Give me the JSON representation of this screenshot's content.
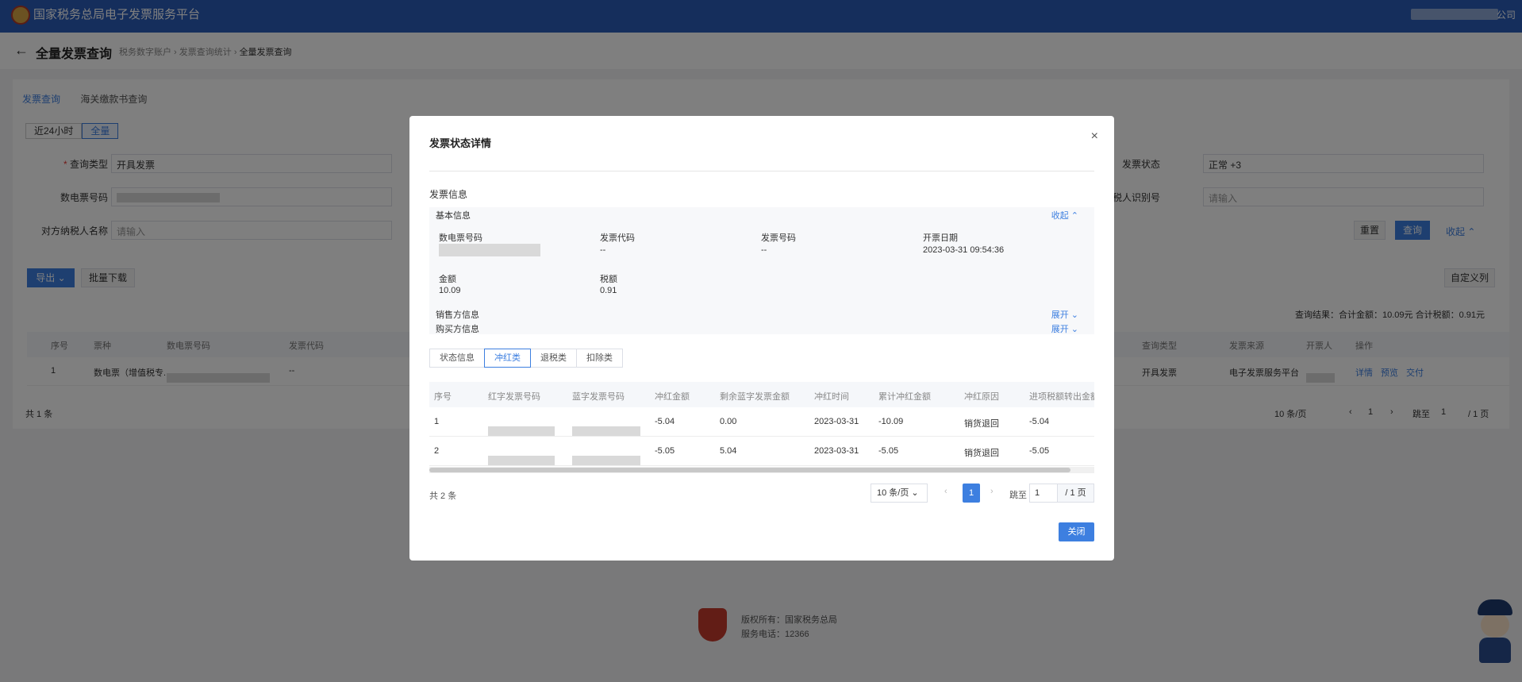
{
  "topbar": {
    "title": "国家税务总局电子发票服务平台",
    "user_suffix": "公司"
  },
  "page": {
    "back": "←",
    "title": "全量发票查询",
    "breadcrumb": [
      "税务数字账户",
      "发票查询统计",
      "全量发票查询"
    ],
    "tabs": [
      "发票查询",
      "海关缴款书查询"
    ],
    "time_filters": [
      "近24小时",
      "全量"
    ],
    "form": {
      "query_type_label": "查询类型",
      "query_type_value": "开具发票",
      "e_invoice_no_label": "数电票号码",
      "counterparty_name_label": "对方纳税人名称",
      "counterparty_name_placeholder": "请输入",
      "invoice_status_label": "发票状态",
      "invoice_status_tag1": "正常",
      "invoice_status_tag2": "+3",
      "counterparty_id_label": "对方纳税人识别号",
      "counterparty_id_placeholder": "请输入"
    },
    "buttons": {
      "reset": "重置",
      "query": "查询",
      "collapse": "收起 ⌃",
      "export": "导出 ⌄",
      "batch_download": "批量下载",
      "custom_columns": "自定义列"
    },
    "summary": "查询结果：合计金额：10.09元   合计税额：0.91元",
    "table": {
      "headers": [
        "序号",
        "票种",
        "数电票号码",
        "发票代码",
        "查询类型",
        "发票来源",
        "开票人",
        "操作"
      ],
      "row": {
        "index": "1",
        "type": "数电票（增值税专...",
        "code": "--",
        "query_type": "开具发票",
        "source": "电子发票服务平台",
        "actions": [
          "详情",
          "预览",
          "交付"
        ]
      }
    },
    "total": "共 1 条",
    "pager": {
      "size": "10 条/页",
      "prev": "‹",
      "page": "1",
      "next": "›",
      "goto": "跳至",
      "goto_value": "1",
      "total_pages": "/ 1 页"
    },
    "footer": {
      "line1": "版权所有：国家税务总局",
      "line2": "服务电话：12366"
    }
  },
  "modal": {
    "title": "发票状态详情",
    "close_icon": "×",
    "section_title": "发票信息",
    "basic_info": "基本信息",
    "collapse": "收起 ⌃",
    "fields": {
      "e_invoice_no_label": "数电票号码",
      "invoice_code_label": "发票代码",
      "invoice_code_value": "--",
      "invoice_no_label": "发票号码",
      "invoice_no_value": "--",
      "issue_date_label": "开票日期",
      "issue_date_value": "2023-03-31 09:54:36",
      "amount_label": "金额",
      "amount_value": "10.09",
      "tax_label": "税额",
      "tax_value": "0.91"
    },
    "seller_info": "销售方信息",
    "buyer_info": "购买方信息",
    "expand": "展开 ⌄",
    "sub_tabs": [
      "状态信息",
      "冲红类",
      "退税类",
      "扣除类"
    ],
    "active_sub_tab": 1,
    "table": {
      "headers": [
        "序号",
        "红字发票号码",
        "蓝字发票号码",
        "冲红金额",
        "剩余蓝字发票金额",
        "冲红时间",
        "累计冲红金额",
        "冲红原因",
        "进项税额转出金额"
      ],
      "rows": [
        {
          "index": "1",
          "red_amount": "-5.04",
          "remaining": "0.00",
          "time": "2023-03-31",
          "cumulative": "-10.09",
          "reason": "销货退回",
          "transfer": "-5.04"
        },
        {
          "index": "2",
          "red_amount": "-5.05",
          "remaining": "5.04",
          "time": "2023-03-31",
          "cumulative": "-5.05",
          "reason": "销货退回",
          "transfer": "-5.05"
        }
      ]
    },
    "total": "共 2 条",
    "pager": {
      "size": "10 条/页 ⌄",
      "prev": "‹",
      "page": "1",
      "next": "›",
      "goto": "跳至",
      "goto_value": "1",
      "total_pages": "/ 1 页"
    },
    "close_button": "关闭"
  }
}
